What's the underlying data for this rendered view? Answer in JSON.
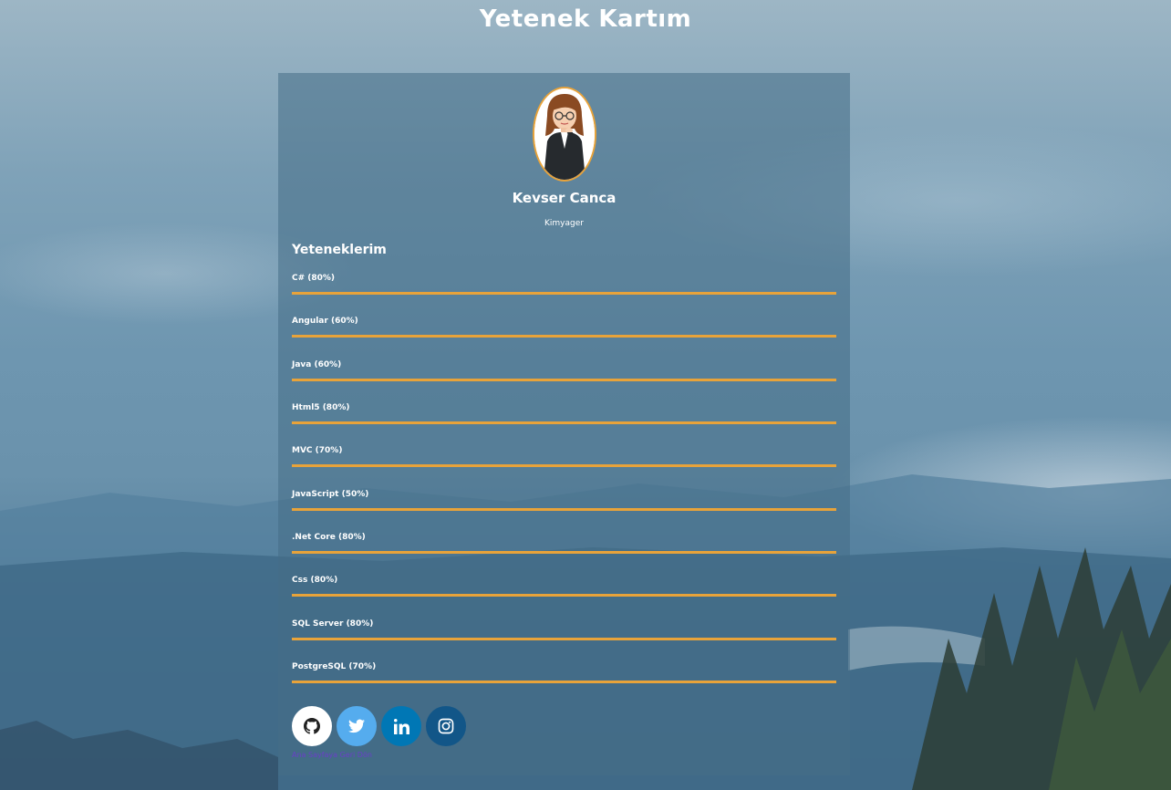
{
  "page": {
    "title": "Yetenek Kartım"
  },
  "profile": {
    "name": "Kevser Canca",
    "job": "Kimyager",
    "avatar_icon": "woman-avatar-icon"
  },
  "skills_heading": "Yeteneklerim",
  "skills": [
    {
      "label": "C# (80%)",
      "level": 0.8
    },
    {
      "label": "Angular (60%)",
      "level": 0.6
    },
    {
      "label": "Java (60%)",
      "level": 0.6
    },
    {
      "label": "Html5 (80%)",
      "level": 0.8
    },
    {
      "label": "MVC (70%)",
      "level": 0.7
    },
    {
      "label": "JavaScript (50%)",
      "level": 0.5
    },
    {
      "label": ".Net Core (80%)",
      "level": 0.8
    },
    {
      "label": "Css (80%)",
      "level": 0.8
    },
    {
      "label": "SQL Server (80%)",
      "level": 0.8
    },
    {
      "label": "PostgreSQL (70%)",
      "level": 0.7
    }
  ],
  "socials": [
    {
      "name": "github-icon",
      "color": "#ffffff",
      "icon_color": "#222222"
    },
    {
      "name": "twitter-icon",
      "color": "#55acee",
      "icon_color": "#ffffff"
    },
    {
      "name": "linkedin-icon",
      "color": "#0077b5",
      "icon_color": "#ffffff"
    },
    {
      "name": "instagram-icon",
      "color": "#125688",
      "icon_color": "#ffffff"
    }
  ],
  "back_link": "Ana Sayfaya Geri Dön",
  "colors": {
    "accent": "#e8a33a",
    "card_bg": "rgba(70,110,135,0.55)",
    "link": "#6a3fc8"
  }
}
